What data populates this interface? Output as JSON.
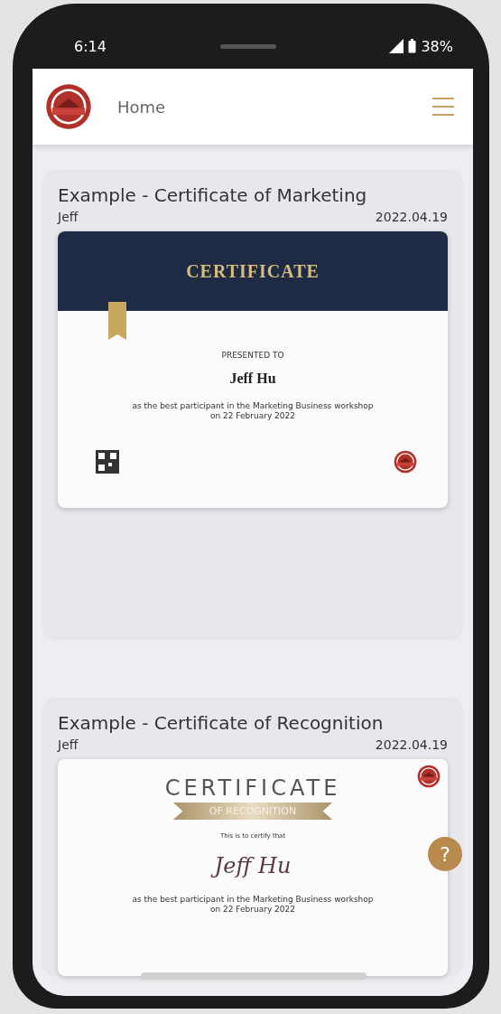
{
  "status_bar": {
    "time": "6:14",
    "battery": "38%"
  },
  "header": {
    "title": "Home"
  },
  "certificates": [
    {
      "title": "Example - Certificate of Marketing",
      "owner": "Jeff",
      "date": "2022.04.19",
      "design": {
        "kind": "dark",
        "heading": "CERTIFICATE",
        "presented": "PRESENTED TO",
        "name": "Jeff Hu",
        "text": "as the best participant in the Marketing Business workshop",
        "when": "on 22 February 2022"
      }
    },
    {
      "title": "Example - Certificate of Recognition",
      "owner": "Jeff",
      "date": "2022.04.19",
      "design": {
        "kind": "ribbon",
        "heading": "CERTIFICATE",
        "subheading": "OF RECOGNITION",
        "presented": "This is to certify that",
        "name": "Jeff Hu",
        "text": "as the best participant in the Marketing Business workshop",
        "when": "on 22 February 2022"
      }
    }
  ],
  "help_button": {
    "label": "?"
  }
}
